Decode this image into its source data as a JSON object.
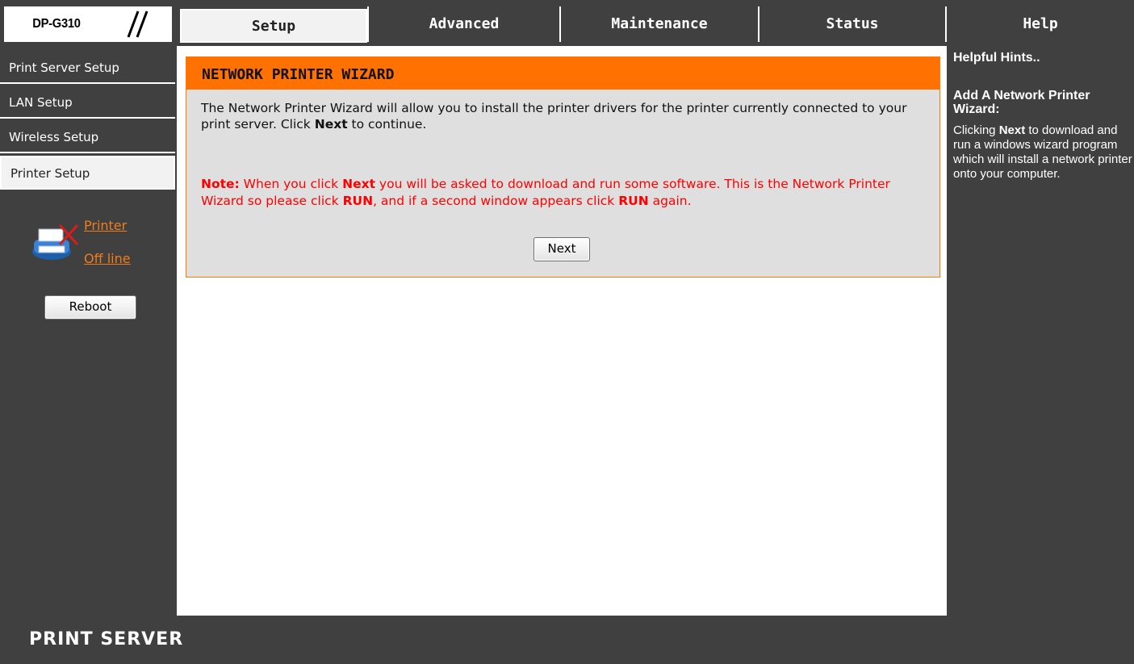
{
  "header": {
    "model": "DP-G310",
    "tabs": [
      {
        "label": "Setup",
        "active": true
      },
      {
        "label": "Advanced",
        "active": false
      },
      {
        "label": "Maintenance",
        "active": false
      },
      {
        "label": "Status",
        "active": false
      },
      {
        "label": "Help",
        "active": false
      }
    ]
  },
  "sidebar": {
    "items": [
      {
        "label": "Print Server Setup",
        "active": false
      },
      {
        "label": "LAN Setup",
        "active": false
      },
      {
        "label": "Wireless Setup",
        "active": false
      },
      {
        "label": "Printer Setup",
        "active": true
      }
    ],
    "printer_status": {
      "icon": "printer-offline-icon",
      "line1": "Printer",
      "line2": "Off line"
    },
    "reboot_label": "Reboot"
  },
  "wizard": {
    "title": "NETWORK PRINTER WIZARD",
    "intro_pre": "The Network Printer Wizard will allow you to install the printer drivers for the printer currently connected to your print server. Click ",
    "intro_bold": "Next",
    "intro_post": " to continue.",
    "note_label": "Note:",
    "note_1": " When you click ",
    "note_next": "Next",
    "note_2": " you will be asked to download and run some software. This is the Network Printer Wizard so please click ",
    "note_run1": "RUN",
    "note_3": ", and if a second window appears click ",
    "note_run2": "RUN",
    "note_4": " again.",
    "next_label": "Next"
  },
  "hints": {
    "title": "Helpful Hints..",
    "subtitle": "Add A Network Printer Wizard:",
    "body_pre": "Clicking ",
    "body_bold": "Next",
    "body_post": " to download and run a windows wizard program which will install a network printer onto your computer."
  },
  "footer": {
    "label": "PRINT SERVER"
  },
  "colors": {
    "chrome": "#404040",
    "accent": "#ff7100",
    "link": "#f07d1a",
    "note": "#ff0000",
    "panel": "#dfdfdf"
  }
}
